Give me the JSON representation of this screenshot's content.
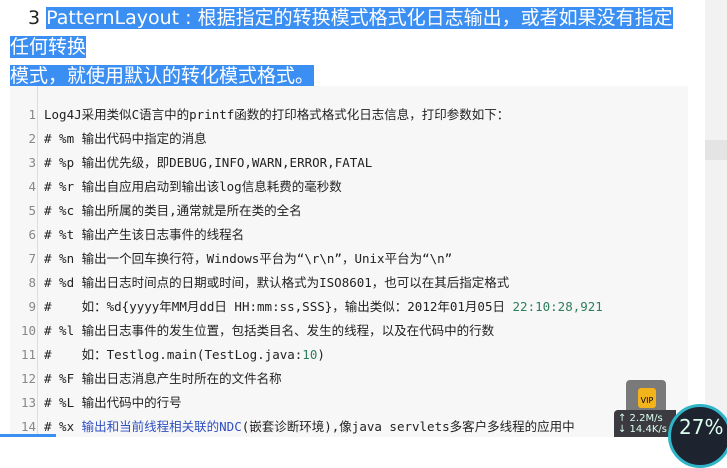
{
  "heading": {
    "number": "3",
    "text_line1": "PatternLayout : 根据指定的转换模式格式化日志输出，或者如果没有指定任何转换",
    "text_line2": "模式，就使用默认的转化模式格式。"
  },
  "code_lines": [
    {
      "n": "1",
      "t": "Log4J采用类似C语言中的printf函数的打印格式格式化日志信息，打印参数如下："
    },
    {
      "n": "2",
      "t": "# %m 输出代码中指定的消息"
    },
    {
      "n": "3",
      "t": "# %p 输出优先级，即DEBUG,INFO,WARN,ERROR,FATAL"
    },
    {
      "n": "4",
      "t": "# %r 输出自应用启动到输出该log信息耗费的毫秒数"
    },
    {
      "n": "5",
      "t": "# %c 输出所属的类目,通常就是所在类的全名"
    },
    {
      "n": "6",
      "t": "# %t 输出产生该日志事件的线程名"
    },
    {
      "n": "7",
      "t": "# %n 输出一个回车换行符，Windows平台为“\\r\\n”，Unix平台为“\\n”"
    },
    {
      "n": "8",
      "t": "# %d 输出日志时间点的日期或时间，默认格式为ISO8601，也可以在其后指定格式"
    },
    {
      "n": "9",
      "t": "#    如：%d{yyyy年MM月dd日 HH:mm:ss,SSS}，输出类似：2012年01月05日 ",
      "t2": "22:10:28,921"
    },
    {
      "n": "10",
      "t": "# %l 输出日志事件的发生位置，包括类目名、发生的线程，以及在代码中的行数"
    },
    {
      "n": "11",
      "t": "#    如：Testlog.main(TestLog.java:",
      "t2": "10",
      "t3": ")"
    },
    {
      "n": "12",
      "t": "# %F 输出日志消息产生时所在的文件名称"
    },
    {
      "n": "13",
      "t": "# %L 输出代码中的行号"
    },
    {
      "n": "14",
      "t": "# %x ",
      "t2": "输出和当前线程相关联的NDC",
      "t3": "(嵌套诊断环境),像java servlets多客户多线程的应用中"
    }
  ],
  "overlay": {
    "badge": "VIP",
    "upload_speed": "↑ 2.2M/s",
    "download_speed": "↓ 14.4K/s",
    "percent": "27%"
  },
  "colors": {
    "highlight": "#3b8ef2",
    "code_bg": "#f7f7f8"
  }
}
